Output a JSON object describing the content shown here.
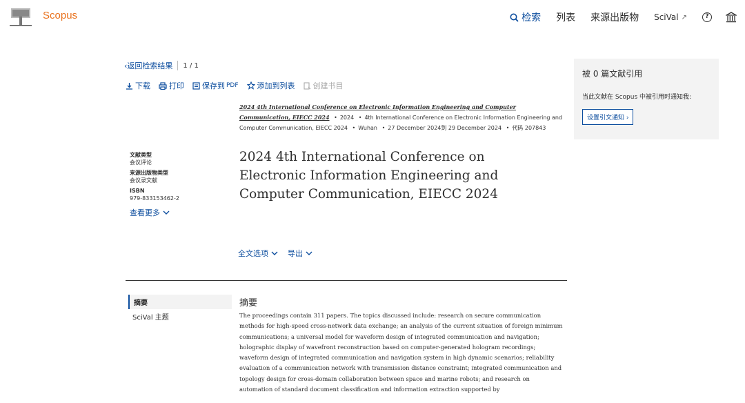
{
  "header": {
    "brand": "Scopus",
    "nav": {
      "search": "检索",
      "lists": "列表",
      "sources": "来源出版物",
      "scival": "SciVal",
      "scival_ext": "↗"
    }
  },
  "backbar": {
    "back_label": "返回检索结果",
    "pager": "1 / 1"
  },
  "toolbar": {
    "download": "下载",
    "print": "打印",
    "save_pdf": "保存到",
    "save_pdf_suffix": "PDF",
    "add_list": "添加到列表",
    "create_bib": "创建书目"
  },
  "source": {
    "name": "2024 4th International Conference on Electronic Information Engineering and Computer Communication, EIECC 2024",
    "year": "2024",
    "proceedings": "4th International Conference on Electronic Information Engineering and Computer Communication, EIECC 2024",
    "location": "Wuhan",
    "dates": "27 December 2024到 29 December 2024",
    "code": "代码 207843"
  },
  "meta": {
    "doc_type_label": "文献类型",
    "doc_type_value": "会议评论",
    "source_type_label": "来源出版物类型",
    "source_type_value": "会议录文献",
    "isbn_label": "ISBN",
    "isbn_value": "979-833153462-2",
    "more_label": "查看更多"
  },
  "title": "2024 4th International Conference on Electronic Information Engineering and Computer Communication, EIECC 2024",
  "options": {
    "fulltext": "全文选项",
    "export": "导出"
  },
  "left_nav": {
    "abstract": "摘要",
    "scival_topics": "SciVal 主题"
  },
  "abstract": {
    "heading": "摘要",
    "text": "The proceedings contain 311 papers. The topics discussed include: research on secure communication methods for high-speed cross-network data exchange; an analysis of the current situation of foreign minimum communications; a universal model for waveform design of integrated communication and navigation; holographic display of wavefront reconstruction based on computer-generated hologram recordings; waveform design of integrated communication and navigation system in high dynamic scenarios; reliability evaluation of a communication network with transmission distance constraint; integrated communication and topology design for cross-domain collaboration between space and marine robots; and research on automation of standard document classification and information extraction supported by"
  },
  "panel": {
    "heading": "被 0 篇文献引用",
    "text": "当此文献在 Scopus 中被引用时通知我:",
    "button": "设置引文通知"
  },
  "colors": {
    "brand_orange": "#e9711c",
    "link_blue": "#0c4d9e",
    "panel_bg": "#f3f3f3"
  }
}
